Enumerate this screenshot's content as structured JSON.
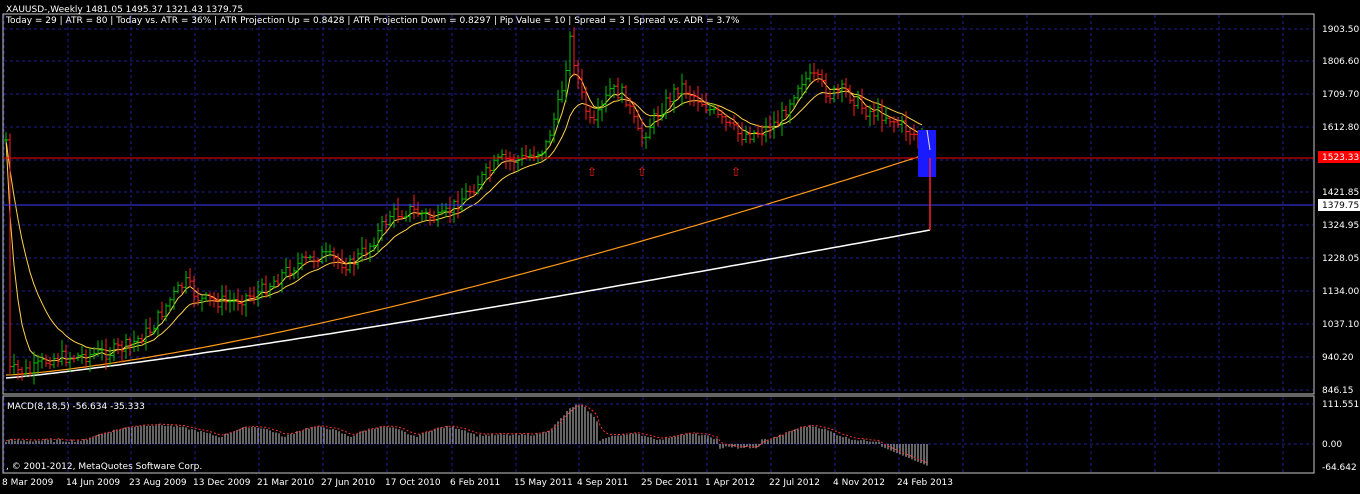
{
  "header": {
    "line1": "XAUUSD-,Weekly  1481.05 1495.37 1321.43 1379.75",
    "line2": "Today = 29   |   ATR = 80   |   Today vs. ATR = 36%   |   ATR Projection Up = 0.8428   |   ATR Projection Down = 0.8297   |   Pip Value = 10   |   Spread = 3   |   Spread vs. ADR = 3.7%"
  },
  "price_axis": {
    "ticks": [
      "1903.50",
      "1806.60",
      "1709.70",
      "1612.80",
      "1421.85",
      "1324.95",
      "1228.05",
      "1134.00",
      "1037.10",
      "940.20",
      "846.15"
    ],
    "bid_label": "1379.75",
    "level_label": "1523.33"
  },
  "macd": {
    "label": "MACD(8,18,5) -56.634 -35.333",
    "ticks": [
      "111.551",
      "0.00",
      "-64.642"
    ]
  },
  "copyright": ", © 2001-2012, MetaQuotes Software Corp.",
  "time_axis": [
    "8 Mar 2009",
    "14 Jun 2009",
    "23 Aug 2009",
    "13 Dec 2009",
    "21 Mar 2010",
    "27 Jun 2010",
    "17 Oct 2010",
    "6 Feb 2011",
    "15 May 2011",
    "4 Sep 2011",
    "25 Dec 2011",
    "1 Apr 2012",
    "22 Jul 2012",
    "4 Nov 2012",
    "24 Feb 2013"
  ],
  "colors": {
    "background": "#000000",
    "grid": "#1f1f8f",
    "bull": "#00c000",
    "bear": "#ff2020",
    "ma_fast": "#ffd24a",
    "ma_mid": "#ffd24a",
    "ma_slow": "#ff9a1a",
    "ma_long": "#ffffff",
    "level_line": "#ff0000",
    "marker_box": "#2020ff",
    "macd_hist": "#c8c8c8",
    "macd_signal": "#ff3030"
  },
  "markers": {
    "arrow_glyph": "⇧"
  }
}
